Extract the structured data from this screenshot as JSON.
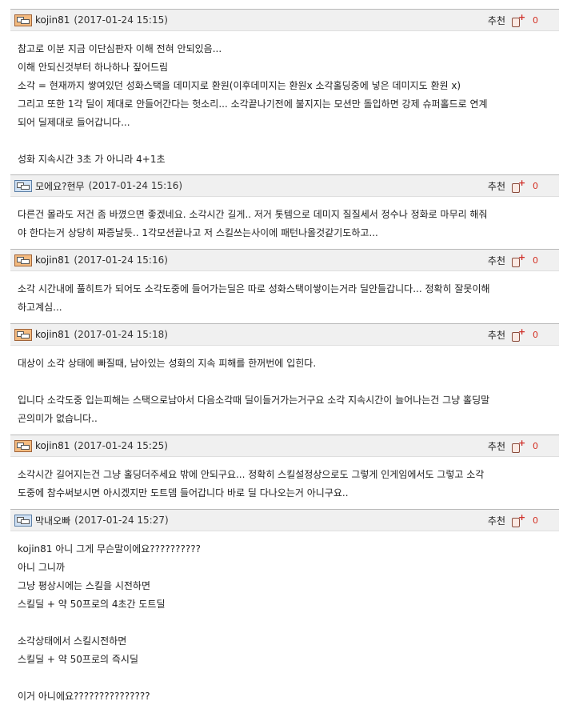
{
  "comments": [
    {
      "nick": "kojin81",
      "date": "(2017-01-24 15:15)",
      "level_color": "orange",
      "rec_label": "추천",
      "count": "0",
      "lines": [
        "참고로 이분 지금 이단심판자 이해 전혀 안되있음...",
        "이해 안되신것부터 하나하나 짚어드림",
        "소각 = 현재까지 쌓여있던 성화스택을 데미지로 환원(이후데미지는 환원x 소각홀딩중에 넣은 데미지도 환원 x)",
        "그리고 또한 1각 딜이 제대로 안들어간다는 헛소리... 소각끝나기전에 불지지는 모션만 돌입하면 강제 슈퍼홀드로 연계",
        "되어 딜제대로 들어갑니다...",
        "",
        "성화 지속시간 3초 가 아니라 4+1초"
      ]
    },
    {
      "nick": "모에요?현무",
      "date": "(2017-01-24 15:16)",
      "level_color": "blue",
      "rec_label": "추천",
      "count": "0",
      "lines": [
        "다른건 몰라도 저건 좀 바꼈으면 좋겠네요. 소각시간 길게.. 저거 톳템으로 데미지 질질세서 정수나 정화로 마무리 해줘",
        "야 한다는거 상당히 짜증날듯.. 1각모션끝나고 저 스킬쓰는사이에 패턴나올것같기도하고..."
      ]
    },
    {
      "nick": "kojin81",
      "date": "(2017-01-24 15:16)",
      "level_color": "orange",
      "rec_label": "추천",
      "count": "0",
      "lines": [
        "소각 시간내에 풀히트가 되어도 소각도중에 들어가는딜은 따로 성화스택이쌓이는거라 딜안들갑니다... 정확히 잘못이해",
        "하고계심..."
      ]
    },
    {
      "nick": "kojin81",
      "date": "(2017-01-24 15:18)",
      "level_color": "orange",
      "rec_label": "추천",
      "count": "0",
      "lines": [
        "대상이 소각 상태에 빠질때, 남아있는 성화의 지속 피해를 한꺼번에 입힌다.",
        "",
        "입니다 소각도중 입는피해는 스택으로남아서 다음소각때 딜이들거가는거구요 소각 지속시간이 늘어나는건 그냥 홀딩말",
        "곤의미가 없습니다.."
      ]
    },
    {
      "nick": "kojin81",
      "date": "(2017-01-24 15:25)",
      "level_color": "orange",
      "rec_label": "추천",
      "count": "0",
      "lines": [
        "소각시간 길어지는건 그냥 홀딩더주세요 밖에 안되구요... 정확히 스킬설정상으로도 그렇게 인게임에서도 그렇고 소각",
        "도중에 참수써보시면 아시겠지만 도트뎀 들어갑니다 바로 딜 다나오는거 아니구요.."
      ]
    },
    {
      "nick": "막내오빠",
      "date": "(2017-01-24 15:27)",
      "level_color": "blue",
      "rec_label": "추천",
      "count": "0",
      "lines": [
        "kojin81 아니 그게 무슨말이에요??????????",
        "아니 그니까",
        "그냥 평상시에는 스킬을 시전하면",
        "스킬딜 + 약 50프로의 4초간 도트딜",
        "",
        "소각상태에서 스킬시전하면",
        "스킬딜 + 약 50프로의 즉시딜",
        "",
        "이거 아니에요???????????????"
      ]
    }
  ]
}
